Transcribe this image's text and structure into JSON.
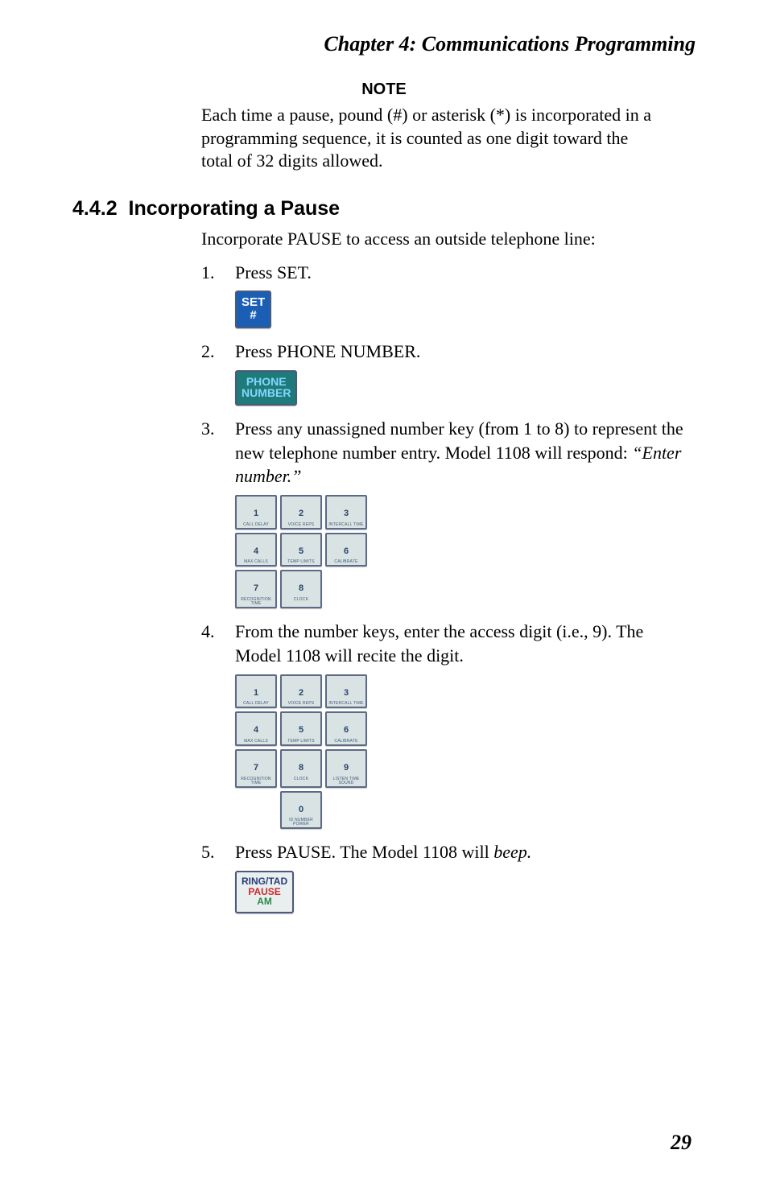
{
  "chapter_title": "Chapter 4: Communications Programming",
  "note": {
    "heading": "NOTE",
    "body": "Each time a pause, pound (#) or asterisk (*) is incorporated in a programming sequence, it is counted as one digit toward the total of 32 digits allowed."
  },
  "section": {
    "number": "4.4.2",
    "title": "Incorporating a Pause",
    "lead": "Incorporate PAUSE to access an outside telephone line:"
  },
  "steps": {
    "s1": {
      "num": "1.",
      "text": "Press SET."
    },
    "s2": {
      "num": "2.",
      "text": "Press PHONE NUMBER."
    },
    "s3": {
      "num": "3.",
      "text_a": "Press any unassigned number key (from 1 to 8) to represent the new telephone number entry. Model 1108 will respond: ",
      "text_b": "“Enter number.”"
    },
    "s4": {
      "num": "4.",
      "text": "From the number keys, enter the access digit (i.e., 9). The Model 1108 will recite the digit."
    },
    "s5": {
      "num": "5.",
      "text_a": "Press PAUSE. The Model 1108 will ",
      "text_b": "beep.",
      "text_c": ""
    }
  },
  "buttons": {
    "set": {
      "line1": "SET",
      "line2": "#"
    },
    "phone": {
      "line1": "PHONE",
      "line2": "NUMBER"
    },
    "ring": {
      "line1": "RING/TAD",
      "line2": "PAUSE",
      "line3": "AM"
    }
  },
  "keypad_labels": {
    "k1": {
      "n": "1",
      "l": "CALL DELAY"
    },
    "k2": {
      "n": "2",
      "l": "VOICE REPS"
    },
    "k3": {
      "n": "3",
      "l": "INTERCALL TIME"
    },
    "k4": {
      "n": "4",
      "l": "MAX CALLS"
    },
    "k5": {
      "n": "5",
      "l": "TEMP LIMITS"
    },
    "k6": {
      "n": "6",
      "l": "CALIBRATE"
    },
    "k7": {
      "n": "7",
      "l": "RECOGNITION TIME"
    },
    "k8": {
      "n": "8",
      "l": "CLOCK"
    },
    "k9": {
      "n": "9",
      "l": "LISTEN TIME SOUND"
    },
    "k0": {
      "n": "0",
      "l": "ID NUMBER POWER"
    }
  },
  "page_number": "29"
}
